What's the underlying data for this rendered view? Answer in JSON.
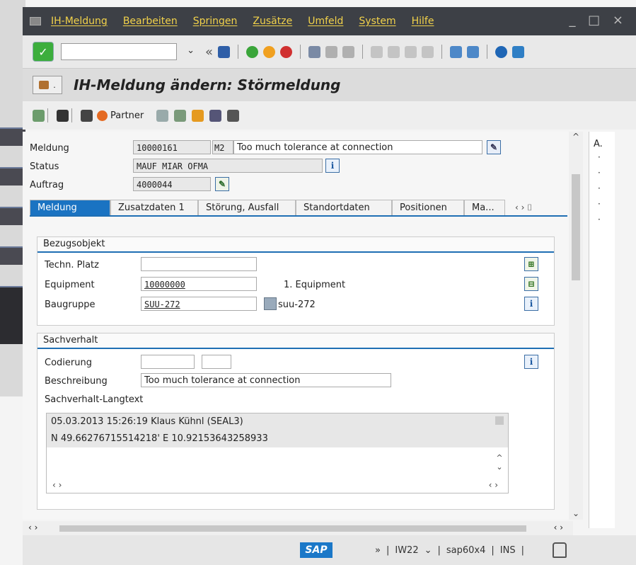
{
  "menu": {
    "items": [
      "IH-Meldung",
      "Bearbeiten",
      "Springen",
      "Zusätze",
      "Umfeld",
      "System",
      "Hilfe"
    ],
    "window_controls": "_ □ ×"
  },
  "toolbar": {
    "ok_symbol": "✓",
    "command_placeholder": "",
    "dropdown": "⌄",
    "back_symbol": "«"
  },
  "title": {
    "text": "IH-Meldung ändern: Störmeldung"
  },
  "apptoolbar": {
    "partner_label": "Partner"
  },
  "header_fields": {
    "meldung_label": "Meldung",
    "meldung_value": "10000161",
    "meldung_type": "M2",
    "meldung_text": "Too much tolerance at connection",
    "status_label": "Status",
    "status_value": "MAUF MIAR OFMA",
    "auftrag_label": "Auftrag",
    "auftrag_value": "4000044"
  },
  "tabs": [
    {
      "label": "Meldung",
      "active": true
    },
    {
      "label": "Zusatzdaten 1",
      "active": false
    },
    {
      "label": "Störung, Ausfall",
      "active": false
    },
    {
      "label": "Standortdaten",
      "active": false
    },
    {
      "label": "Positionen",
      "active": false
    },
    {
      "label": "Ma...",
      "active": false
    }
  ],
  "tab_nav": "‹ › ⌷",
  "bezugsobjekt": {
    "title": "Bezugsobjekt",
    "techn_platz_label": "Techn. Platz",
    "techn_platz_value": "",
    "equipment_label": "Equipment",
    "equipment_value": "10000000",
    "equipment_desc": "1. Equipment",
    "baugruppe_label": "Baugruppe",
    "baugruppe_value": "SUU-272",
    "baugruppe_desc": "suu-272"
  },
  "sachverhalt": {
    "title": "Sachverhalt",
    "codierung_label": "Codierung",
    "codierung_value1": "",
    "codierung_value2": "",
    "beschreibung_label": "Beschreibung",
    "beschreibung_value": "Too much tolerance at connection",
    "langtext_label": "Sachverhalt-Langtext",
    "langtext_lines": [
      "05.03.2013 15:26:19 Klaus Kühnl (SEAL3)",
      "N 49.66276715514218' E 10.92153643258933"
    ]
  },
  "scroll": {
    "left_right": "‹ ›",
    "up": "^",
    "down": "⌄"
  },
  "sidepanel": {
    "header": "A.",
    "bullets": [
      "·",
      "·",
      "·",
      "·",
      "·"
    ]
  },
  "statusbar": {
    "sap": "SAP",
    "chevron": "»",
    "transaction": "IW22",
    "system": "sap60x4",
    "mode": "INS"
  }
}
